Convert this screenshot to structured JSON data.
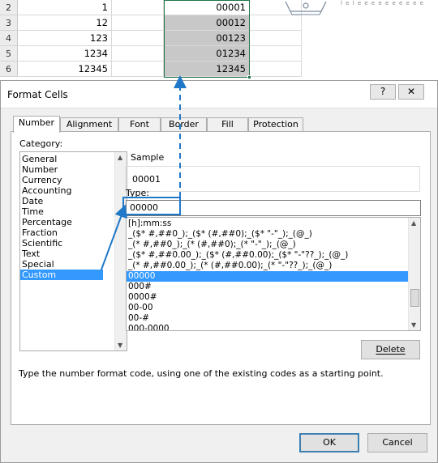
{
  "sheet": {
    "rows": [
      {
        "num": "2",
        "a": "1",
        "b": "00001"
      },
      {
        "num": "3",
        "a": "12",
        "b": "00012"
      },
      {
        "num": "4",
        "a": "123",
        "b": "00123"
      },
      {
        "num": "5",
        "a": "1234",
        "b": "01234"
      },
      {
        "num": "6",
        "a": "12345",
        "b": "12345"
      }
    ],
    "stray_text": "l e l e e e e e e e e e e"
  },
  "dialog": {
    "title": "Format Cells",
    "help_label": "?",
    "close_label": "✕",
    "tabs": [
      "Number",
      "Alignment",
      "Font",
      "Border",
      "Fill",
      "Protection"
    ],
    "category_label": "Category:",
    "categories": [
      "General",
      "Number",
      "Currency",
      "Accounting",
      "Date",
      "Time",
      "Percentage",
      "Fraction",
      "Scientific",
      "Text",
      "Special",
      "Custom"
    ],
    "selected_category": "Custom",
    "sample_label": "Sample",
    "sample_value": "00001",
    "type_label": "Type:",
    "type_value": "00000",
    "formats": [
      "[h]:mm:ss",
      "_($* #,##0_);_($* (#,##0);_($* \"-\"_);_(@_)",
      "_(* #,##0_);_(* (#,##0);_(* \"-\"_);_(@_)",
      "_($* #,##0.00_);_($* (#,##0.00);_($* \"-\"??_);_(@_)",
      "_(* #,##0.00_);_(* (#,##0.00);_(* \"-\"??_);_(@_)",
      "00000",
      "000#",
      "0000#",
      "00-00",
      "00-#",
      "000-0000"
    ],
    "selected_format": "00000",
    "delete_label": "Delete",
    "description": "Type the number format code, using one of the existing codes as a starting point.",
    "ok_label": "OK",
    "cancel_label": "Cancel"
  },
  "colors": {
    "accent": "#1f78c8",
    "selection": "#3399ff",
    "excel_green": "#217346"
  }
}
